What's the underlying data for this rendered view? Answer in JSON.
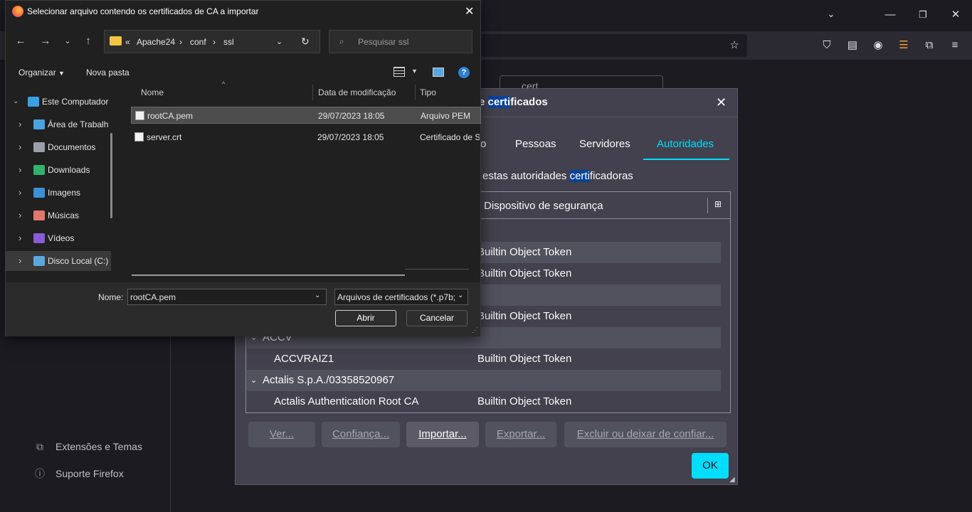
{
  "browser": {
    "pref_search_value": "cert",
    "sidebar_links": [
      {
        "label": "Extensões e Temas",
        "icon": "puzzle-icon"
      },
      {
        "label": "Suporte Firefox",
        "icon": "help-icon"
      }
    ]
  },
  "cert_manager": {
    "title_prefix": "e ",
    "title_highlight": "certi",
    "title_rest": "ficados",
    "tabs": [
      "o",
      "Pessoas",
      "Servidores",
      "Autoridades"
    ],
    "active_tab": "Autoridades",
    "desc_prefix": "estas autoridades ",
    "desc_highlight": "certi",
    "desc_rest": "ficadoras",
    "column_device": "Dispositivo de segurança",
    "rows": [
      {
        "name": "",
        "device": "",
        "alt": false
      },
      {
        "name": "",
        "device": "Builtin Object Token",
        "alt": true
      },
      {
        "name": "",
        "device": "Builtin Object Token",
        "alt": false
      },
      {
        "name": "",
        "device": "",
        "alt": true
      },
      {
        "name": "",
        "device": "Builtin Object Token",
        "alt": false
      },
      {
        "name": "ACCV",
        "device": "",
        "alt": true,
        "group": true
      },
      {
        "name": "ACCVRAIZ1",
        "device": "Builtin Object Token",
        "alt": false
      },
      {
        "name": "Actalis S.p.A./03358520967",
        "device": "",
        "alt": true,
        "group": true
      },
      {
        "name": "Actalis Authentication Root CA",
        "device": "Builtin Object Token",
        "alt": false
      }
    ],
    "buttons": {
      "view": "Ver...",
      "trust": "Confiança...",
      "import": "Importar...",
      "export": "Exportar...",
      "delete": "Excluir ou deixar de confiar..."
    },
    "ok": "OK"
  },
  "file_dialog": {
    "title": "Selecionar arquivo contendo os certificados de CA a importar",
    "breadcrumb": [
      "Apache24",
      "conf",
      "ssl"
    ],
    "breadcrumb_prefix": "«",
    "search_placeholder": "Pesquisar ssl",
    "toolbar": {
      "organize": "Organizar",
      "new_folder": "Nova pasta"
    },
    "nav_items": [
      {
        "label": "Este Computador",
        "color": "#3aa0e6",
        "top": true
      },
      {
        "label": "Área de Trabalh",
        "color": "#4aa3df"
      },
      {
        "label": "Documentos",
        "color": "#9aa0a6"
      },
      {
        "label": "Downloads",
        "color": "#2fb36b"
      },
      {
        "label": "Imagens",
        "color": "#3d8fd6"
      },
      {
        "label": "Músicas",
        "color": "#e0786b"
      },
      {
        "label": "Vídeos",
        "color": "#8a5bd6"
      },
      {
        "label": "Disco Local (C:)",
        "color": "#5aa7e0",
        "selected": true
      }
    ],
    "columns": {
      "name": "Nome",
      "date": "Data de modificação",
      "type": "Tipo"
    },
    "files": [
      {
        "name": "rootCA.pem",
        "date": "29/07/2023 18:05",
        "type": "Arquivo PEM",
        "selected": true
      },
      {
        "name": "server.crt",
        "date": "29/07/2023 18:05",
        "type": "Certificado de S",
        "selected": false
      }
    ],
    "filename_label": "Nome:",
    "filename_value": "rootCA.pem",
    "filter_value": "Arquivos de certificados (*.p7b;",
    "open_label": "Abrir",
    "cancel_label": "Cancelar"
  }
}
